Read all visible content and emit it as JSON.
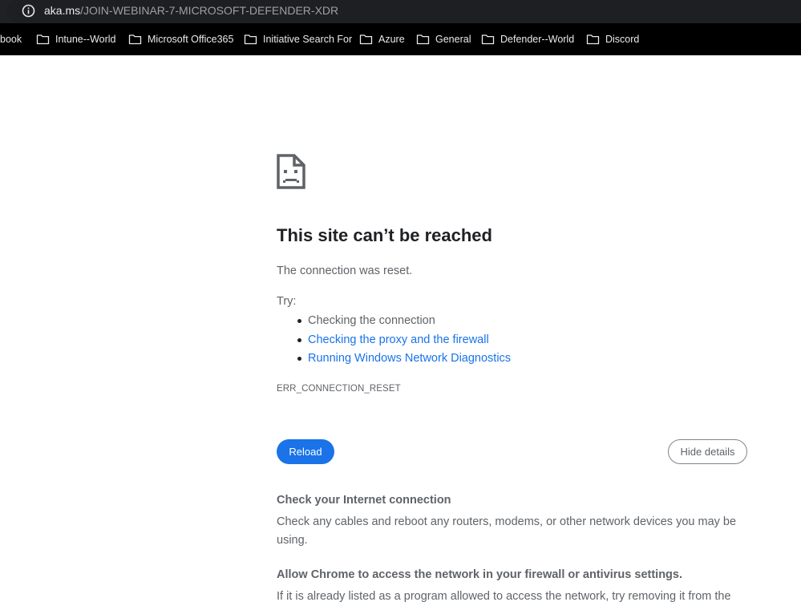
{
  "address_bar": {
    "icon": "info-icon",
    "url_host": "aka.ms",
    "url_path": "/JOIN-WEBINAR-7-MICROSOFT-DEFENDER-XDR"
  },
  "bookmarks": [
    {
      "label": "book",
      "icon": "none"
    },
    {
      "label": "Intune--World",
      "icon": "folder-icon"
    },
    {
      "label": "Microsoft Office365",
      "icon": "folder-icon"
    },
    {
      "label": "Initiative Search For",
      "icon": "folder-icon"
    },
    {
      "label": "Azure",
      "icon": "folder-icon"
    },
    {
      "label": "General",
      "icon": "folder-icon"
    },
    {
      "label": "Defender--World",
      "icon": "folder-icon"
    },
    {
      "label": "Discord",
      "icon": "folder-icon"
    }
  ],
  "error_page": {
    "icon": "sad-page-icon",
    "title": "This site can’t be reached",
    "message": "The connection was reset.",
    "try_label": "Try:",
    "suggestions": [
      {
        "text": "Checking the connection",
        "link": false
      },
      {
        "text": "Checking the proxy and the firewall",
        "link": true
      },
      {
        "text": "Running Windows Network Diagnostics",
        "link": true
      }
    ],
    "error_code": "ERR_CONNECTION_RESET",
    "reload_label": "Reload",
    "hide_details_label": "Hide details",
    "details": [
      {
        "title": "Check your Internet connection",
        "body": "Check any cables and reboot any routers, modems, or other network devices you may be using."
      },
      {
        "title": "Allow Chrome to access the network in your firewall or antivirus settings.",
        "body": "If it is already listed as a program allowed to access the network, try removing it from the"
      }
    ]
  },
  "colors": {
    "accent": "#1a73e8",
    "text": "#5f6368",
    "heading": "#202124",
    "toolbar": "#202124",
    "bookmarks_bar": "#000000"
  }
}
